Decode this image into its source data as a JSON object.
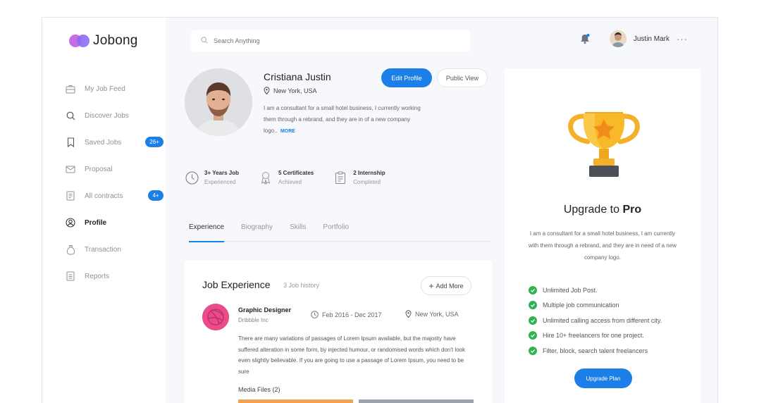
{
  "app": {
    "name": "Jobong"
  },
  "sidebar": {
    "items": [
      {
        "label": "My Job Feed",
        "icon": "briefcase-icon",
        "active": false,
        "badge": ""
      },
      {
        "label": "Discover Jobs",
        "icon": "search-icon",
        "active": false,
        "badge": ""
      },
      {
        "label": "Saved Jobs",
        "icon": "bookmark-icon",
        "active": false,
        "badge": "26+"
      },
      {
        "label": "Proposal",
        "icon": "mail-icon",
        "active": false,
        "badge": ""
      },
      {
        "label": "All contracts",
        "icon": "document-icon",
        "active": false,
        "badge": "4+"
      },
      {
        "label": "Profile",
        "icon": "user-icon",
        "active": true,
        "badge": ""
      },
      {
        "label": "Transaction",
        "icon": "money-bag-icon",
        "active": false,
        "badge": ""
      },
      {
        "label": "Reports",
        "icon": "report-icon",
        "active": false,
        "badge": ""
      }
    ]
  },
  "header": {
    "search_placeholder": "Search Anything",
    "username": "Justin Mark",
    "more": "···"
  },
  "profile": {
    "name": "Cristiana Justin",
    "location": "New York, USA",
    "bio": "I am a consultant for a small hotel business, I currently working them through a rebrand, and they are in of a new company logo..",
    "more_link": "MORE",
    "edit_label": "Edit Profile",
    "public_label": "Public View",
    "stats": [
      {
        "value": "3+ Years Job",
        "sub": "Experienced",
        "icon": "clock-icon"
      },
      {
        "value": "5 Certificates",
        "sub": "Achieved",
        "icon": "award-icon"
      },
      {
        "value": "2 Internship",
        "sub": "Completed",
        "icon": "clipboard-icon"
      }
    ]
  },
  "tabs": [
    "Experience",
    "Biography",
    "Skills",
    "Portfolio"
  ],
  "job_experience": {
    "title": "Job Experience",
    "count": "3 Job history",
    "add_label": "Add More",
    "job": {
      "role": "Graphic Designer",
      "company": "Dribbble Inc",
      "dates": "Feb 2016 - Dec 2017",
      "location": "New York, USA",
      "description": "There are many variations of passages of Lorem Ipsum available, but the majority have suffered alteration in some form, by injected humour, or randomised words which don't look even slightly believable. If you are going to use a passage of Lorem Ipsum, you need to be sure",
      "media": "Media Files (2)"
    }
  },
  "pro": {
    "title_prefix": "Upgrade to",
    "title_bold": "Pro",
    "description": "I am a consultant for a small hotel business, I am currently with them through a rebrand, and they are in need of a new company logo.",
    "features": [
      "Unlimited Job Post.",
      "Multiple job communication",
      "Unlimited calling access from different city.",
      "Hire 10+ freelancers for one project.",
      "Filter, block, search talent freelancers"
    ],
    "button": "Upgrade Plan"
  },
  "colors": {
    "accent": "#1c7fe8",
    "success": "#2db552",
    "dribbble": "#ea4c89",
    "trophy": "#f7b928"
  }
}
